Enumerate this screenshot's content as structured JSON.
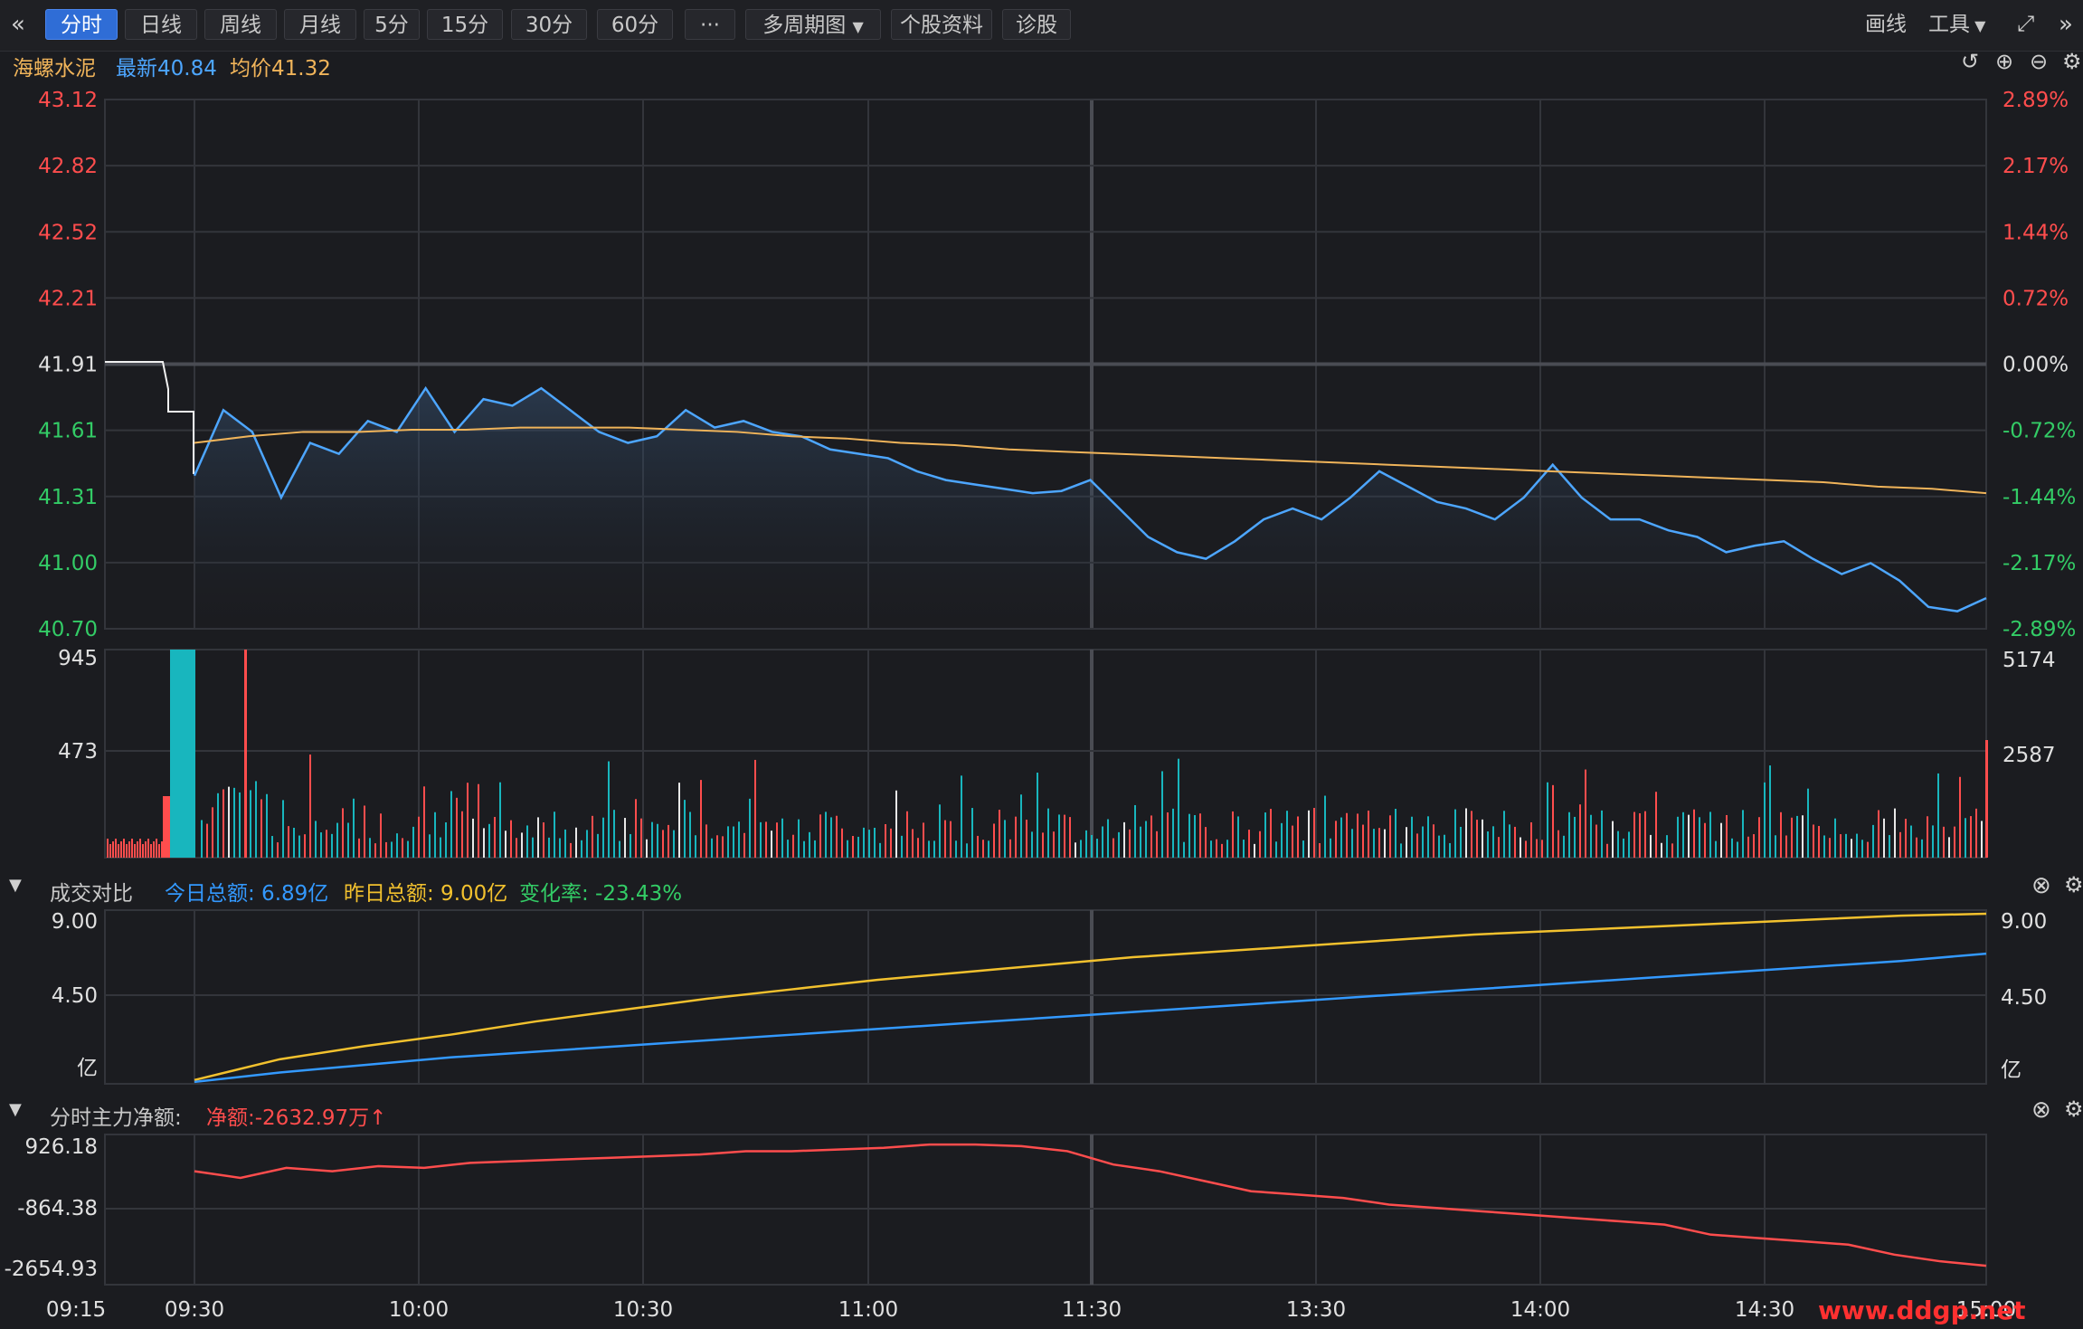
{
  "toolbar": {
    "back_icon": "double-chevron-left-icon",
    "tabs": [
      {
        "label": "分时",
        "active": true
      },
      {
        "label": "日线"
      },
      {
        "label": "周线"
      },
      {
        "label": "月线"
      },
      {
        "label": "5分"
      },
      {
        "label": "15分"
      },
      {
        "label": "30分"
      },
      {
        "label": "60分"
      }
    ],
    "more_label": "···",
    "multi_period": "多周期图",
    "stock_profile": "个股资料",
    "diagnosis": "诊股",
    "draw_label": "画线",
    "tools_label": "工具"
  },
  "stock": {
    "name": "海螺水泥",
    "latest_label": "最新40.84",
    "avg_label": "均价41.32"
  },
  "colors": {
    "background": "#1b1c20",
    "grid": "#33353b",
    "price": "#4da6ff",
    "avg": "#f0b45a",
    "up": "#ff4d4d",
    "down": "#33cc66",
    "teal": "#18b6be",
    "today_amount": "#3399ff",
    "yesterday_amount": "#f2c12e",
    "net_flow": "#ff4d4d"
  },
  "volume_panel": {
    "left_ticks": [
      "945",
      "473"
    ],
    "right_ticks": [
      "5174",
      "2587"
    ]
  },
  "compare_panel": {
    "title": "成交对比",
    "today_label": "今日总额: 6.89亿",
    "yesterday_label": "昨日总额: 9.00亿",
    "change_label": "变化率: -23.43%",
    "left_ticks": [
      "9.00",
      "4.50",
      "亿"
    ],
    "right_ticks": [
      "9.00",
      "4.50",
      "亿"
    ]
  },
  "flow_panel": {
    "title": "分时主力净额:",
    "net_label": "净额:-2632.97万",
    "ticks": [
      "926.18",
      "-864.38",
      "-2654.93"
    ]
  },
  "watermark": "www.ddgp.net",
  "chart_data": [
    {
      "type": "line",
      "name": "intraday-price",
      "x_ticks": [
        "09:15",
        "09:30",
        "10:00",
        "10:30",
        "11:00",
        "11:30",
        "13:30",
        "14:00",
        "14:30",
        "15:00"
      ],
      "left_ticks": [
        "43.12",
        "42.82",
        "42.52",
        "42.21",
        "41.91",
        "41.61",
        "41.31",
        "41.00",
        "40.70"
      ],
      "right_ticks": [
        "2.89%",
        "2.17%",
        "1.44%",
        "0.72%",
        "0.00%",
        "-0.72%",
        "-1.44%",
        "-2.17%",
        "-2.89%"
      ],
      "ylim": [
        40.7,
        43.12
      ],
      "prev_close": 41.91,
      "series": [
        {
          "name": "最新",
          "values": [
            41.4,
            41.7,
            41.6,
            41.3,
            41.55,
            41.5,
            41.65,
            41.6,
            41.8,
            41.6,
            41.75,
            41.72,
            41.8,
            41.7,
            41.6,
            41.55,
            41.58,
            41.7,
            41.62,
            41.65,
            41.6,
            41.58,
            41.52,
            41.5,
            41.48,
            41.42,
            41.38,
            41.36,
            41.34,
            41.32,
            41.33,
            41.38,
            41.25,
            41.12,
            41.05,
            41.02,
            41.1,
            41.2,
            41.25,
            41.2,
            41.3,
            41.42,
            41.35,
            41.28,
            41.25,
            41.2,
            41.3,
            41.45,
            41.3,
            41.2,
            41.2,
            41.15,
            41.12,
            41.05,
            41.08,
            41.1,
            41.02,
            40.95,
            41.0,
            40.92,
            40.8,
            40.78,
            40.84
          ]
        },
        {
          "name": "均价",
          "values": [
            41.55,
            41.58,
            41.6,
            41.6,
            41.61,
            41.61,
            41.62,
            41.62,
            41.62,
            41.61,
            41.6,
            41.58,
            41.57,
            41.55,
            41.54,
            41.52,
            41.51,
            41.5,
            41.49,
            41.48,
            41.47,
            41.46,
            41.45,
            41.44,
            41.43,
            41.42,
            41.41,
            41.4,
            41.39,
            41.38,
            41.37,
            41.35,
            41.34,
            41.32
          ]
        }
      ]
    },
    {
      "type": "bar",
      "name": "intraday-volume",
      "ylim": [
        0,
        945
      ]
    },
    {
      "type": "line",
      "name": "turnover-compare",
      "ylim": [
        0,
        9.0
      ],
      "series": [
        {
          "name": "今日总额",
          "values": [
            0.1,
            0.6,
            1.0,
            1.4,
            1.7,
            2.0,
            2.3,
            2.6,
            2.9,
            3.2,
            3.5,
            3.8,
            4.1,
            4.4,
            4.7,
            5.0,
            5.3,
            5.6,
            5.9,
            6.2,
            6.5,
            6.89
          ]
        },
        {
          "name": "昨日总额",
          "values": [
            0.2,
            1.3,
            2.0,
            2.6,
            3.3,
            3.9,
            4.5,
            5.0,
            5.5,
            5.9,
            6.3,
            6.7,
            7.0,
            7.3,
            7.6,
            7.9,
            8.1,
            8.3,
            8.5,
            8.7,
            8.9,
            9.0
          ]
        }
      ]
    },
    {
      "type": "line",
      "name": "main-net-flow",
      "ylim": [
        -3200,
        1300
      ],
      "series": [
        {
          "name": "净额",
          "values": [
            200,
            0,
            300,
            200,
            350,
            300,
            450,
            500,
            550,
            600,
            650,
            700,
            800,
            800,
            850,
            900,
            1000,
            1000,
            950,
            800,
            400,
            200,
            -100,
            -400,
            -500,
            -600,
            -800,
            -900,
            -1000,
            -1100,
            -1200,
            -1300,
            -1400,
            -1700,
            -1800,
            -1900,
            -2000,
            -2300,
            -2500,
            -2632.97
          ]
        }
      ]
    }
  ]
}
